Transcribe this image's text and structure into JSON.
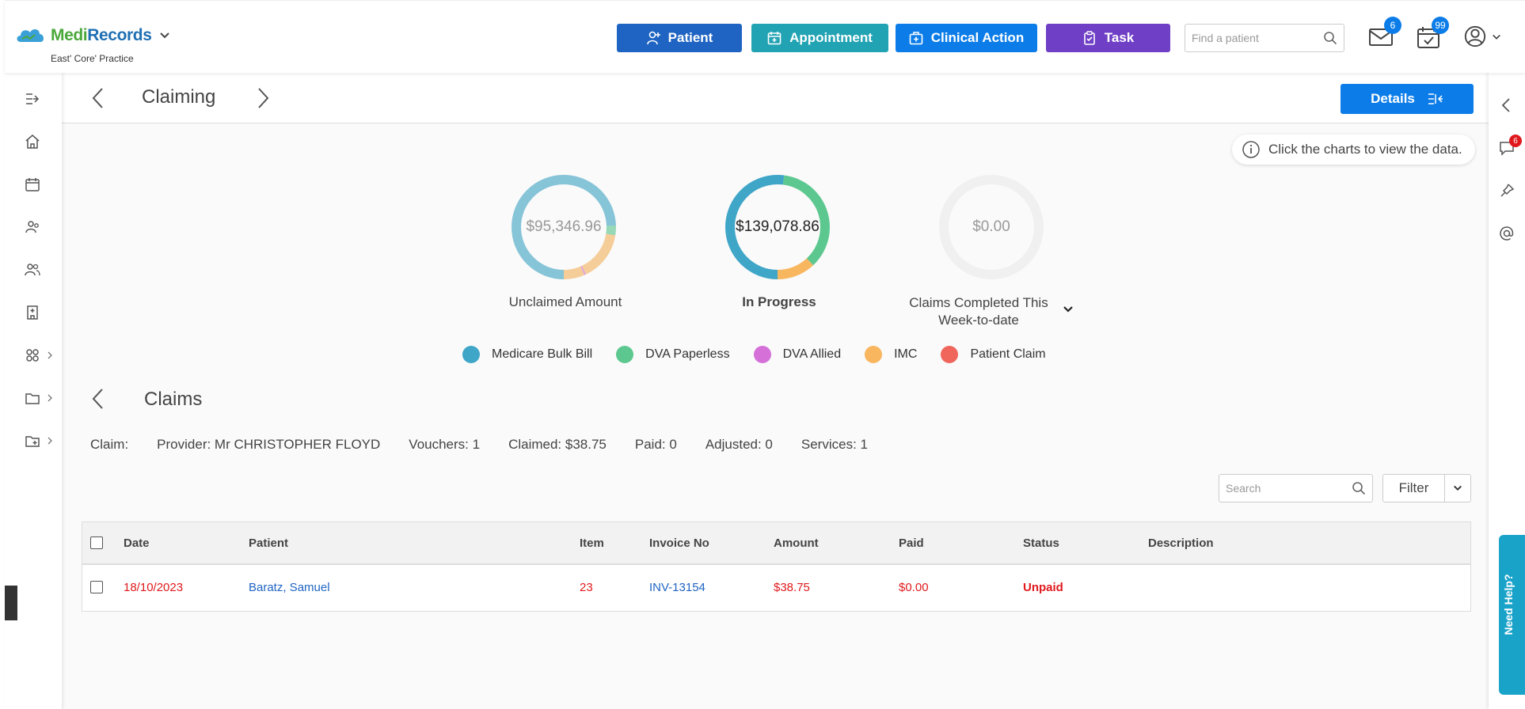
{
  "app": {
    "brand_part1": "Medi",
    "brand_part2": "Records",
    "practice": "East' Core' Practice"
  },
  "header": {
    "buttons": [
      {
        "label": "Patient",
        "icon": "add-person-icon",
        "color": "#1f64c3"
      },
      {
        "label": "Appointment",
        "icon": "calendar-add-icon",
        "color": "#21a3b3"
      },
      {
        "label": "Clinical Action",
        "icon": "medical-kit-icon",
        "color": "#0c7de8"
      },
      {
        "label": "Task",
        "icon": "clipboard-icon",
        "color": "#6f3fc6"
      }
    ],
    "search_placeholder": "Find a patient",
    "mail_count": "6",
    "tasks_count": "99"
  },
  "page": {
    "title": "Claiming",
    "details_label": "Details",
    "info_text": "Click the charts to view the data."
  },
  "charts": [
    {
      "value": "$95,346.96",
      "label": "Unclaimed Amount"
    },
    {
      "value": "$139,078.86",
      "label": "In Progress"
    },
    {
      "value": "$0.00",
      "label": "Claims Completed This Week-to-date"
    }
  ],
  "chart_data": [
    {
      "type": "pie",
      "title": "Unclaimed Amount",
      "center_label": "$95,346.96",
      "series": [
        {
          "name": "Medicare Bulk Bill",
          "value": 0.745,
          "color": "#3fa6c8"
        },
        {
          "name": "DVA Paperless",
          "value": 0.03,
          "color": "#5cc88f"
        },
        {
          "name": "IMC",
          "value": 0.155,
          "color": "#f8b65f"
        },
        {
          "name": "DVA Allied",
          "value": 0.005,
          "color": "#d570d8"
        },
        {
          "name": "IMC",
          "value": 0.065,
          "color": "#f8b65f"
        }
      ],
      "faded": true
    },
    {
      "type": "pie",
      "title": "In Progress",
      "center_label": "$139,078.86",
      "series": [
        {
          "name": "Medicare Bulk Bill",
          "value": 0.52,
          "color": "#3fa6c8"
        },
        {
          "name": "DVA Paperless",
          "value": 0.36,
          "color": "#5cc88f"
        },
        {
          "name": "IMC",
          "value": 0.12,
          "color": "#f8b65f"
        }
      ],
      "faded": false
    },
    {
      "type": "pie",
      "title": "Claims Completed This Week-to-date",
      "center_label": "$0.00",
      "series": [],
      "faded": true
    }
  ],
  "legend": [
    {
      "name": "Medicare Bulk Bill",
      "color": "#3fa6c8"
    },
    {
      "name": "DVA Paperless",
      "color": "#5cc88f"
    },
    {
      "name": "DVA Allied",
      "color": "#d570d8"
    },
    {
      "name": "IMC",
      "color": "#f8b65f"
    },
    {
      "name": "Patient Claim",
      "color": "#f0665c"
    }
  ],
  "claims": {
    "title": "Claims",
    "info": {
      "claim": "Claim:",
      "provider": "Provider: Mr CHRISTOPHER FLOYD",
      "vouchers": "Vouchers: 1",
      "claimed": "Claimed: $38.75",
      "paid": "Paid: 0",
      "adjusted": "Adjusted: 0",
      "services": "Services: 1"
    },
    "search_placeholder": "Search",
    "filter_label": "Filter",
    "columns": [
      "Date",
      "Patient",
      "Item",
      "Invoice No",
      "Amount",
      "Paid",
      "Status",
      "Description"
    ],
    "rows": [
      {
        "date": "18/10/2023",
        "patient": "Baratz, Samuel",
        "item": "23",
        "invoice": "INV-13154",
        "amount": "$38.75",
        "paid": "$0.00",
        "status": "Unpaid",
        "description": ""
      }
    ]
  },
  "right_sidebar": {
    "notes_count": "6",
    "help_label": "Need Help?"
  }
}
